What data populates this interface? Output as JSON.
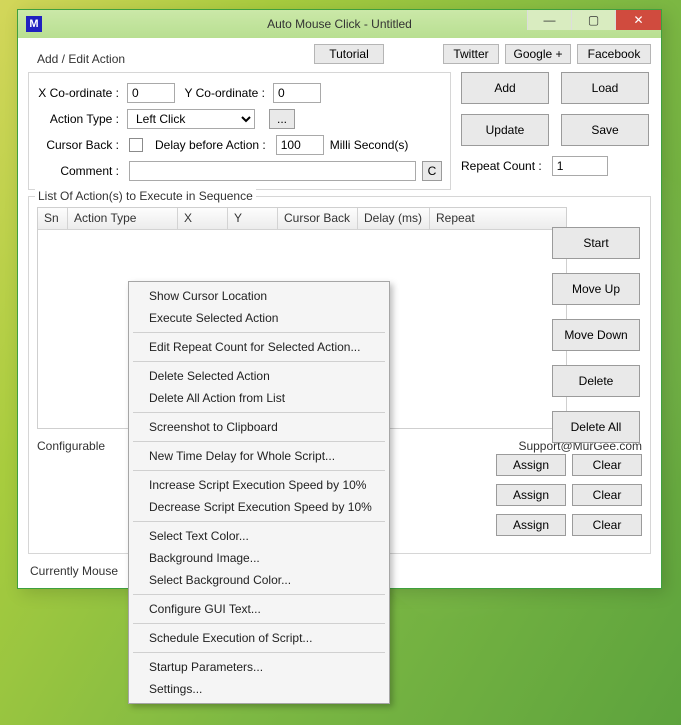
{
  "titlebar": {
    "icon_letter": "M",
    "title": "Auto Mouse Click - Untitled",
    "min": "—",
    "max": "▢",
    "close": "✕"
  },
  "top_buttons": {
    "tutorial": "Tutorial",
    "twitter": "Twitter",
    "google": "Google +",
    "facebook": "Facebook"
  },
  "add_edit": {
    "legend": "Add / Edit Action",
    "x_label": "X Co-ordinate :",
    "x_value": "0",
    "y_label": "Y Co-ordinate :",
    "y_value": "0",
    "action_type_label": "Action Type :",
    "action_type_value": "Left Click",
    "more_btn": "...",
    "cursor_back_label": "Cursor Back :",
    "delay_label": "Delay before Action :",
    "delay_value": "100",
    "delay_units": "Milli Second(s)",
    "comment_label": "Comment :",
    "comment_value": "",
    "c_btn": "C",
    "repeat_label": "Repeat Count :",
    "repeat_value": "1"
  },
  "main_buttons": {
    "add": "Add",
    "load": "Load",
    "update": "Update",
    "save": "Save"
  },
  "list": {
    "legend": "List Of Action(s) to Execute in Sequence",
    "cols": {
      "sn": "Sn",
      "action_type": "Action Type",
      "x": "X",
      "y": "Y",
      "cursor_back": "Cursor Back",
      "delay": "Delay (ms)",
      "repeat": "Repeat"
    },
    "side": {
      "start": "Start",
      "moveup": "Move Up",
      "movedown": "Move Down",
      "delete": "Delete",
      "deleteall": "Delete All"
    },
    "support": "Support@MurGee.com"
  },
  "configurable_prefix": "Configurable",
  "kb": {
    "assign": "Assign",
    "clear": "Clear"
  },
  "status_prefix": "Currently Mouse",
  "context_menu": {
    "items": [
      "Show Cursor Location",
      "Execute Selected Action",
      "-",
      "Edit Repeat Count for Selected Action...",
      "-",
      "Delete Selected Action",
      "Delete All Action from List",
      "-",
      "Screenshot to Clipboard",
      "-",
      "New Time Delay for Whole Script...",
      "-",
      "Increase Script Execution Speed by 10%",
      "Decrease Script Execution Speed by 10%",
      "-",
      "Select Text Color...",
      "Background Image...",
      "Select Background Color...",
      "-",
      "Configure GUI Text...",
      "-",
      "Schedule Execution of Script...",
      "-",
      "Startup Parameters...",
      "Settings..."
    ]
  }
}
